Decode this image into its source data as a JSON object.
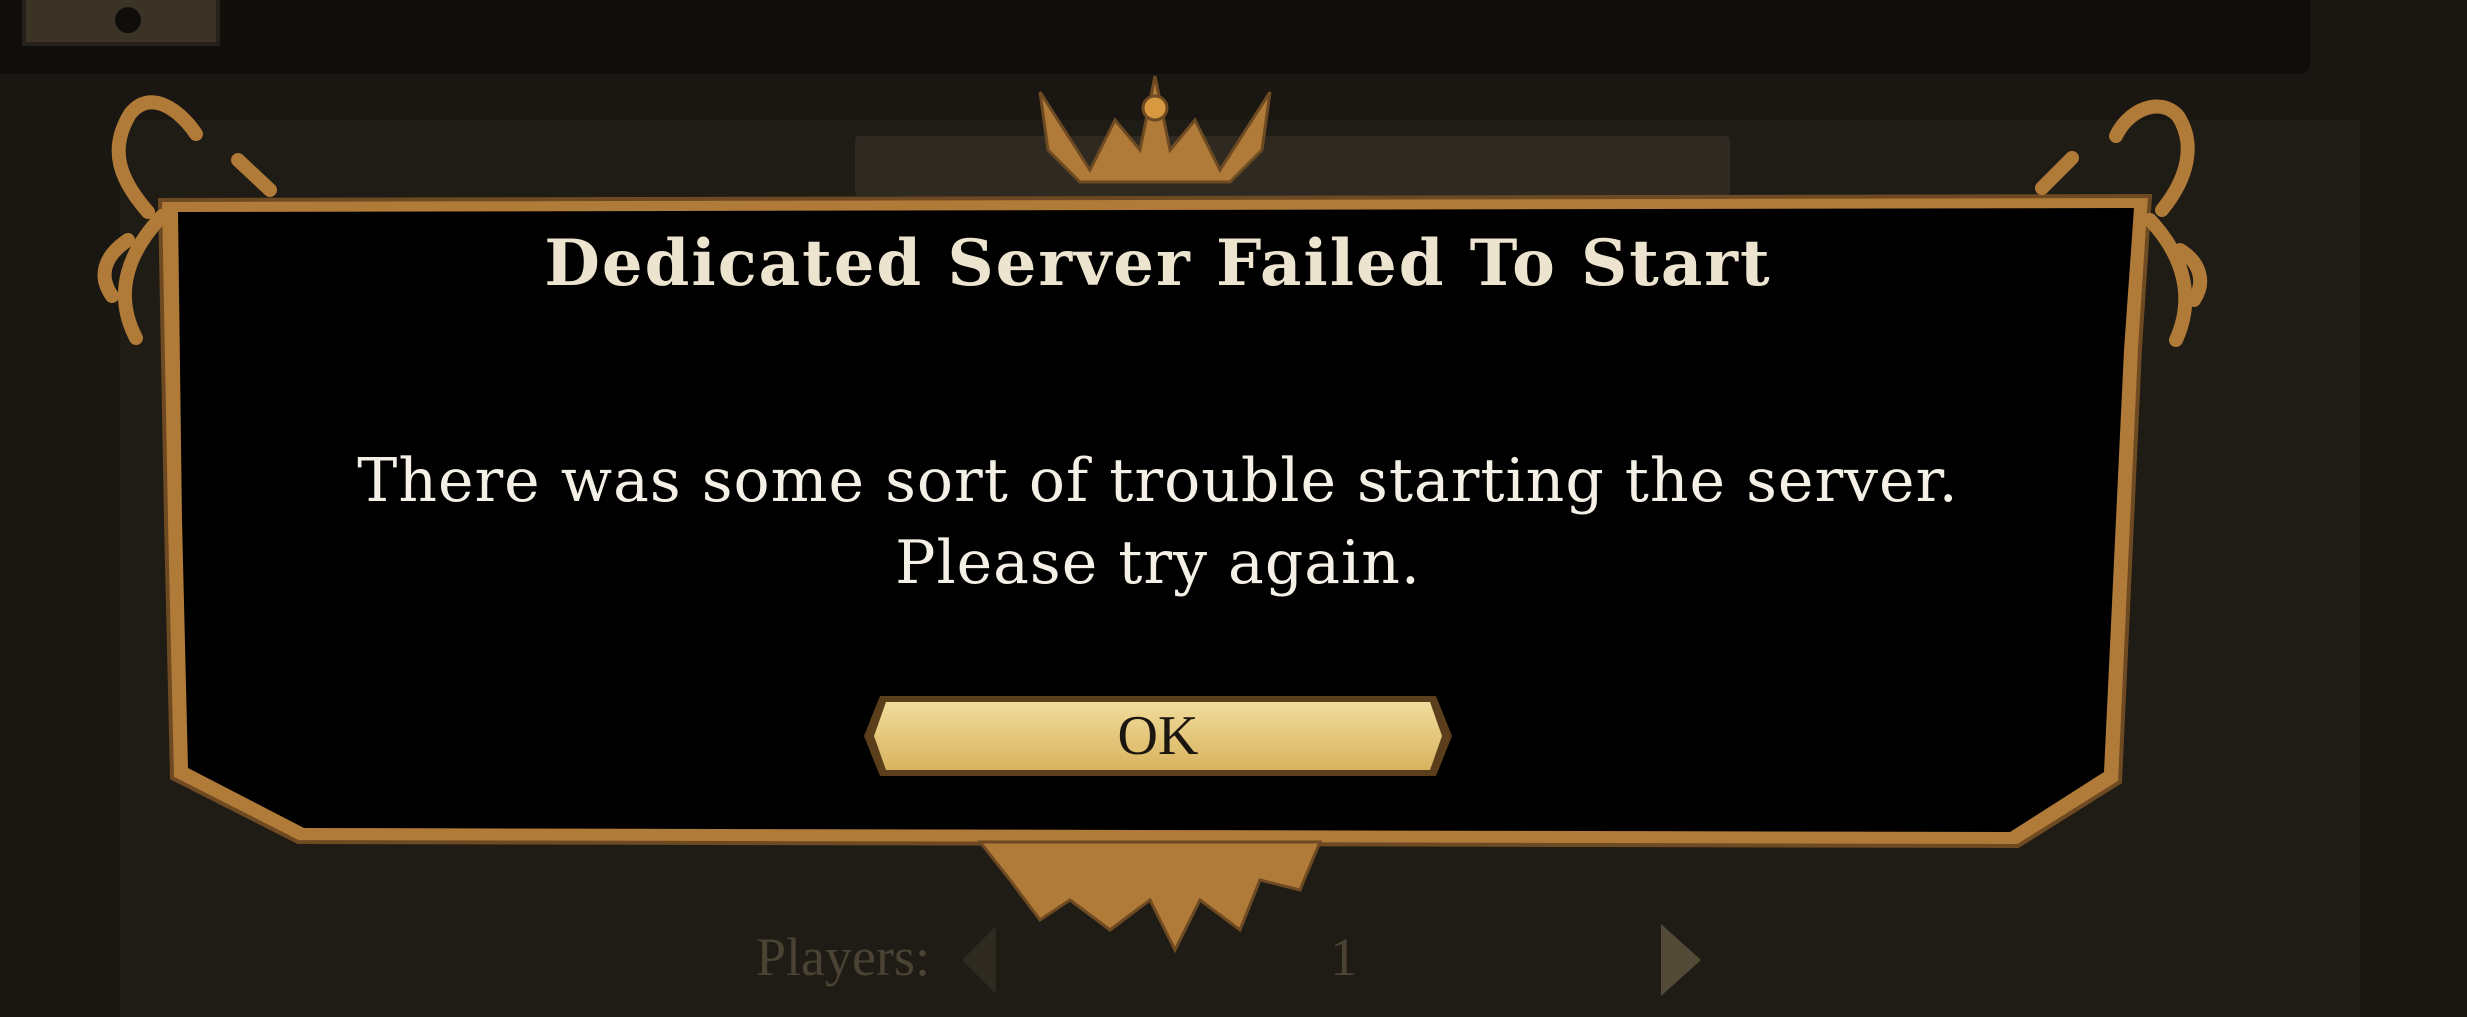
{
  "background": {
    "players_label": "Players:",
    "players_value": "1"
  },
  "dialog": {
    "title": "Dedicated Server Failed To Start",
    "message": "There was some sort of trouble starting the server. Please try again.",
    "ok_label": "OK"
  },
  "colors": {
    "frame": "#b07a38",
    "frame_shadow": "#6e4a22",
    "dialog_bg": "#000000",
    "title_text": "#ece4cf",
    "button_fill": "#e7c97a"
  },
  "icons": {
    "avatar": "character-silhouette-icon",
    "players_left": "arrow-left-icon",
    "players_right": "arrow-right-icon"
  }
}
